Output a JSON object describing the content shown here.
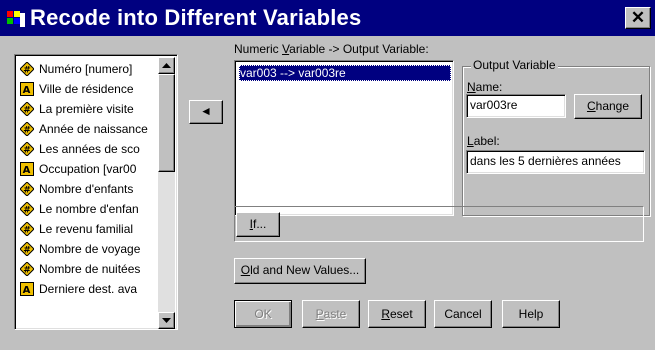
{
  "window": {
    "title": "Recode into Different Variables",
    "close_glyph": "✕"
  },
  "colors": {
    "titlebar": "#000080",
    "face": "#c0c0c0",
    "selection": "#000080",
    "numeric_icon": "#f0c000",
    "string_icon": "#f0c000"
  },
  "source_list": {
    "items": [
      {
        "label": "Numéro [numero]",
        "icon": "numeric-variable-icon"
      },
      {
        "label": "Ville de résidence",
        "icon": "string-variable-icon"
      },
      {
        "label": "La première visite",
        "icon": "numeric-variable-icon"
      },
      {
        "label": "Année de naissance",
        "icon": "numeric-variable-icon"
      },
      {
        "label": "Les années de sco",
        "icon": "numeric-variable-icon"
      },
      {
        "label": "Occupation [var00",
        "icon": "string-variable-icon"
      },
      {
        "label": "Nombre d'enfants",
        "icon": "numeric-variable-icon"
      },
      {
        "label": "Le nombre d'enfan",
        "icon": "numeric-variable-icon"
      },
      {
        "label": "Le revenu familial",
        "icon": "numeric-variable-icon"
      },
      {
        "label": "Nombre de voyage",
        "icon": "numeric-variable-icon"
      },
      {
        "label": "Nombre de nuitées",
        "icon": "numeric-variable-icon"
      },
      {
        "label": "Derniere dest. ava",
        "icon": "string-variable-icon"
      }
    ]
  },
  "move_button": {
    "glyph": "◄"
  },
  "output_list": {
    "label_pre": "Numeric ",
    "label_mnemonic": "V",
    "label_post": "ariable -> Output Variable:",
    "selected_item": "var003 --> var003re"
  },
  "output_variable": {
    "group_label": "Output Variable",
    "name_label_mnemonic": "N",
    "name_label_rest": "ame:",
    "name_value": "var003re",
    "change_label_mnemonic": "C",
    "change_label_rest": "hange",
    "label_label_mnemonic": "L",
    "label_label_rest": "abel:",
    "label_value": "dans les 5 dernières années"
  },
  "buttons": {
    "if_mnemonic": "I",
    "if_rest": "f...",
    "old_new_mnemonic": "O",
    "old_new_rest": "ld and New Values...",
    "ok": "OK",
    "paste_mnemonic": "P",
    "paste_rest": "aste",
    "reset_mnemonic": "R",
    "reset_rest": "eset",
    "cancel": "Cancel",
    "help": "Help"
  }
}
